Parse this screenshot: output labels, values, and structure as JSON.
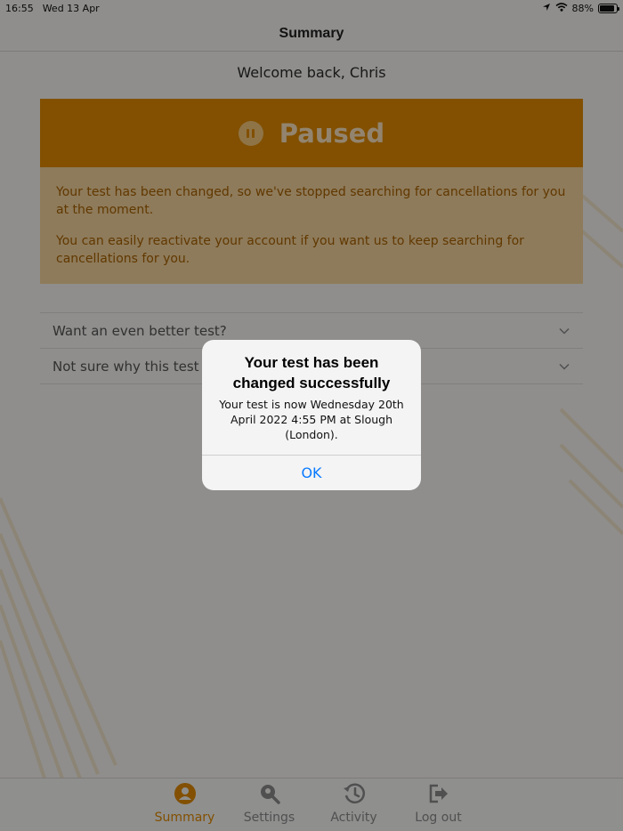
{
  "status_bar": {
    "time": "16:55",
    "date": "Wed 13 Apr",
    "battery": "88%"
  },
  "nav": {
    "title": "Summary"
  },
  "welcome": "Welcome back, Chris",
  "status_card": {
    "title": "Paused",
    "paragraph1": "Your test has been changed, so we've stopped searching for cancellations for you at the moment.",
    "paragraph2": "You can easily reactivate your account if you want us to keep searching for cancellations for you."
  },
  "accordion": {
    "items": [
      {
        "label": "Want an even better test?"
      },
      {
        "label": "Not sure why this test was"
      }
    ]
  },
  "tabs": [
    {
      "label": "Summary",
      "icon": "user-icon",
      "active": true
    },
    {
      "label": "Settings",
      "icon": "location-search-icon",
      "active": false
    },
    {
      "label": "Activity",
      "icon": "history-icon",
      "active": false
    },
    {
      "label": "Log out",
      "icon": "logout-icon",
      "active": false
    }
  ],
  "alert": {
    "title": "Your test has been changed successfully",
    "message": "Your test is now Wednesday 20th April 2022 4:55 PM at Slough (London).",
    "ok_label": "OK"
  },
  "colors": {
    "accent": "#e08a00",
    "link": "#0a7bff"
  }
}
